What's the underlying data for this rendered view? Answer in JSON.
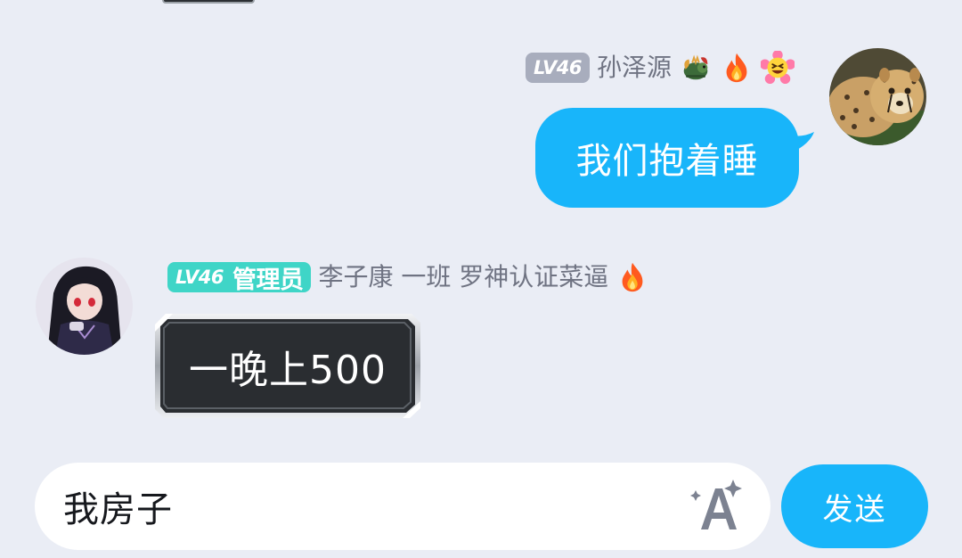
{
  "messages": [
    {
      "side": "right",
      "level": "LV46",
      "nickname": "孙泽源",
      "emojis": [
        "dragon-icon",
        "fire-icon",
        "grin-flower-icon"
      ],
      "text": "我们抱着睡",
      "bubble_color": "#18b5fa",
      "avatar": "cheetah-avatar"
    },
    {
      "side": "left",
      "level": "LV46",
      "role": "管理员",
      "nickname": "李子康 一班 罗神认证菜逼",
      "emojis": [
        "fire-icon"
      ],
      "text": "一晚上500",
      "bubble_style": "dark-framed",
      "avatar": "anime-girl-avatar"
    }
  ],
  "input": {
    "value": "我房子",
    "font_icon": "font-style-sparkle-icon"
  },
  "send_button": {
    "label": "发送",
    "color": "#18b5fa"
  },
  "colors": {
    "background": "#eaedf5",
    "level_badge_grey": "#a8adbd",
    "level_badge_teal": "#3fd5c7",
    "nickname": "#6f7382"
  }
}
